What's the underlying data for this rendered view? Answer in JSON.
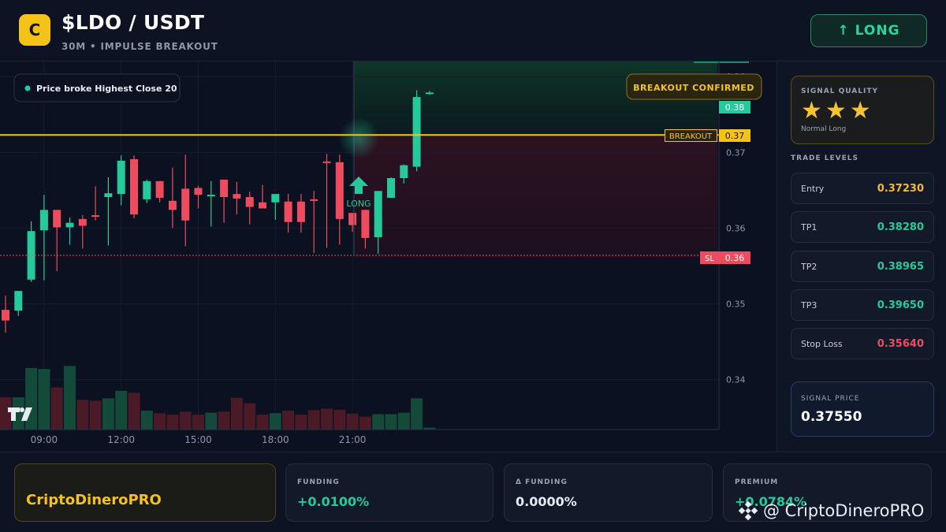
{
  "header": {
    "logo_letter": "C",
    "pair": "$LDO / USDT",
    "subtitle": "30M • IMPULSE BREAKOUT",
    "signal_button": "↑ LONG"
  },
  "chart": {
    "badge_text": "Price broke Highest Close 20",
    "breakout_confirmed": "BREAKOUT CONFIRMED",
    "breakout_label": "BREAKOUT",
    "breakout_value": "0.37",
    "sl_label": "SL",
    "sl_value": "0.36",
    "current_value": "0.38",
    "long_marker": "LONG",
    "tv_logo": "TV",
    "colors": {
      "up": "#26c99a",
      "down": "#ef4b5f",
      "breakout": "#f5c21a",
      "sl": "#ef4b5f"
    }
  },
  "chart_data": {
    "type": "candlestick",
    "y_ticks": [
      "0.38",
      "0.37",
      "0.36",
      "0.35",
      "0.34"
    ],
    "y_tick_values": [
      0.38,
      0.37,
      0.36,
      0.35,
      0.34
    ],
    "x_ticks": [
      "09:00",
      "12:00",
      "15:00",
      "18:00",
      "21:00"
    ],
    "x_tick_index": [
      3,
      9,
      15,
      21,
      27
    ],
    "ylim": [
      0.3334,
      0.382
    ],
    "breakout_level": 0.3723,
    "stop_loss": 0.3564,
    "candles": [
      {
        "o": 0.3492,
        "h": 0.3511,
        "l": 0.3462,
        "c": 0.3478
      },
      {
        "o": 0.3491,
        "h": 0.3517,
        "l": 0.3484,
        "c": 0.3517
      },
      {
        "o": 0.3532,
        "h": 0.3609,
        "l": 0.3529,
        "c": 0.3596
      },
      {
        "o": 0.3597,
        "h": 0.3644,
        "l": 0.3531,
        "c": 0.3624
      },
      {
        "o": 0.3624,
        "h": 0.3603,
        "l": 0.3543,
        "c": 0.3601
      },
      {
        "o": 0.3601,
        "h": 0.3614,
        "l": 0.3578,
        "c": 0.3607
      },
      {
        "o": 0.3612,
        "h": 0.3617,
        "l": 0.3573,
        "c": 0.3603
      },
      {
        "o": 0.3617,
        "h": 0.3655,
        "l": 0.361,
        "c": 0.3616
      },
      {
        "o": 0.3641,
        "h": 0.3667,
        "l": 0.3577,
        "c": 0.3646
      },
      {
        "o": 0.3645,
        "h": 0.3696,
        "l": 0.363,
        "c": 0.3689
      },
      {
        "o": 0.3691,
        "h": 0.3696,
        "l": 0.3613,
        "c": 0.3618
      },
      {
        "o": 0.3638,
        "h": 0.3664,
        "l": 0.3633,
        "c": 0.3662
      },
      {
        "o": 0.3662,
        "h": 0.3649,
        "l": 0.3634,
        "c": 0.364
      },
      {
        "o": 0.3636,
        "h": 0.368,
        "l": 0.36,
        "c": 0.3624
      },
      {
        "o": 0.3652,
        "h": 0.3697,
        "l": 0.3576,
        "c": 0.361
      },
      {
        "o": 0.3653,
        "h": 0.3656,
        "l": 0.3626,
        "c": 0.3644
      },
      {
        "o": 0.3644,
        "h": 0.3662,
        "l": 0.3602,
        "c": 0.3644
      },
      {
        "o": 0.3664,
        "h": 0.3659,
        "l": 0.3607,
        "c": 0.3641
      },
      {
        "o": 0.3645,
        "h": 0.3661,
        "l": 0.3618,
        "c": 0.3639
      },
      {
        "o": 0.3641,
        "h": 0.3648,
        "l": 0.3605,
        "c": 0.3628
      },
      {
        "o": 0.3634,
        "h": 0.3657,
        "l": 0.3634,
        "c": 0.3626
      },
      {
        "o": 0.3634,
        "h": 0.3645,
        "l": 0.3611,
        "c": 0.3645
      },
      {
        "o": 0.3635,
        "h": 0.3645,
        "l": 0.3594,
        "c": 0.3608
      },
      {
        "o": 0.3635,
        "h": 0.3645,
        "l": 0.3594,
        "c": 0.3608
      },
      {
        "o": 0.3638,
        "h": 0.3649,
        "l": 0.3567,
        "c": 0.3637
      },
      {
        "o": 0.3688,
        "h": 0.3698,
        "l": 0.3574,
        "c": 0.3687
      },
      {
        "o": 0.3687,
        "h": 0.3697,
        "l": 0.3578,
        "c": 0.3612
      },
      {
        "o": 0.362,
        "h": 0.3616,
        "l": 0.3595,
        "c": 0.3604
      },
      {
        "o": 0.3624,
        "h": 0.3618,
        "l": 0.3573,
        "c": 0.3587
      },
      {
        "o": 0.3588,
        "h": 0.3627,
        "l": 0.3566,
        "c": 0.3649
      },
      {
        "o": 0.364,
        "h": 0.3667,
        "l": 0.364,
        "c": 0.3666
      },
      {
        "o": 0.3666,
        "h": 0.3684,
        "l": 0.3659,
        "c": 0.3683
      },
      {
        "o": 0.3681,
        "h": 0.3782,
        "l": 0.3675,
        "c": 0.3773
      },
      {
        "o": 0.3778,
        "h": 0.3781,
        "l": 0.3776,
        "c": 0.3779
      }
    ],
    "volumes": [
      6.5,
      6.5,
      12.4,
      12.2,
      8.5,
      12.8,
      6.0,
      5.8,
      6.3,
      7.8,
      7.4,
      3.8,
      3.3,
      3.0,
      3.6,
      3.0,
      3.4,
      3.6,
      6.4,
      5.3,
      3.0,
      3.3,
      3.8,
      3.0,
      3.9,
      4.2,
      4.0,
      3.2,
      2.6,
      3.1,
      3.1,
      3.4,
      6.3,
      0.4
    ],
    "xlabel": "",
    "ylabel": ""
  },
  "signal_quality": {
    "title": "SIGNAL QUALITY",
    "stars": "★★★",
    "rating": 3,
    "subtitle": "Normal Long"
  },
  "trade_levels": {
    "title": "TRADE LEVELS",
    "items": [
      {
        "label": "Entry",
        "value": "0.37230",
        "color": "#f5b92a"
      },
      {
        "label": "TP1",
        "value": "0.38280",
        "color": "#26c99a"
      },
      {
        "label": "TP2",
        "value": "0.38965",
        "color": "#26c99a"
      },
      {
        "label": "TP3",
        "value": "0.39650",
        "color": "#26c99a"
      },
      {
        "label": "Stop Loss",
        "value": "0.35640",
        "color": "#ef4b5f"
      }
    ]
  },
  "signal_price": {
    "title": "SIGNAL PRICE",
    "value": "0.37550"
  },
  "footer": {
    "brand": "CriptoDineroPRO",
    "cards": [
      {
        "title": "FUNDING",
        "value": "+0.0100%",
        "color": "#26c99a"
      },
      {
        "title": "Δ FUNDING",
        "value": "0.0000%",
        "color": "#e6ebf2"
      },
      {
        "title": "PREMIUM",
        "value": "+0.0784%",
        "color": "#26c99a"
      }
    ],
    "watermark": "@ CriptoDineroPRO"
  }
}
